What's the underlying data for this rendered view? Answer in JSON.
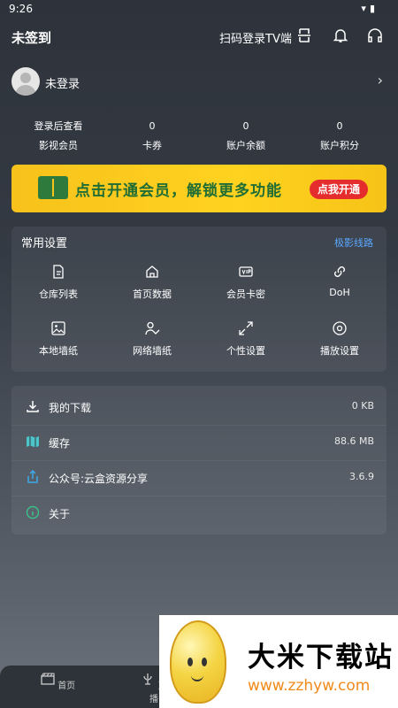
{
  "status": {
    "time": "9:26"
  },
  "header": {
    "title": "未签到",
    "scan_tv": "扫码登录TV端",
    "icons": [
      "scan-icon",
      "bell-icon",
      "headset-icon"
    ]
  },
  "user": {
    "name": "未登录"
  },
  "stats": [
    {
      "value": "登录后查看",
      "label": "影视会员"
    },
    {
      "value": "0",
      "label": "卡券"
    },
    {
      "value": "0",
      "label": "账户余额"
    },
    {
      "value": "0",
      "label": "账户积分"
    }
  ],
  "banner": {
    "text": "点击开通会员，解锁更多功能",
    "button": "点我开通"
  },
  "settings": {
    "title": "常用设置",
    "link": "极影线路",
    "items": [
      {
        "label": "仓库列表",
        "icon": "document-icon"
      },
      {
        "label": "首页数据",
        "icon": "home-icon"
      },
      {
        "label": "会员卡密",
        "icon": "vip-card-icon"
      },
      {
        "label": "DoH",
        "icon": "link-icon"
      },
      {
        "label": "本地墙纸",
        "icon": "image-icon"
      },
      {
        "label": "网络墙纸",
        "icon": "user-check-icon"
      },
      {
        "label": "个性设置",
        "icon": "expand-icon"
      },
      {
        "label": "播放设置",
        "icon": "play-settings-icon"
      }
    ]
  },
  "list": [
    {
      "label": "我的下载",
      "value": "0 KB",
      "icon": "download-icon"
    },
    {
      "label": "缓存",
      "value": "88.6 MB",
      "icon": "map-icon"
    },
    {
      "label": "公众号:云盒资源分享",
      "value": "3.6.9",
      "icon": "share-icon"
    },
    {
      "label": "关于",
      "value": "",
      "icon": "info-icon"
    }
  ],
  "bottom_nav": [
    {
      "label": "首页",
      "icon": "clapper-icon"
    },
    {
      "label": "直播",
      "icon": "live-icon"
    }
  ],
  "watermark": {
    "title": "大米下载站",
    "url": "www.zzhyw.com"
  }
}
